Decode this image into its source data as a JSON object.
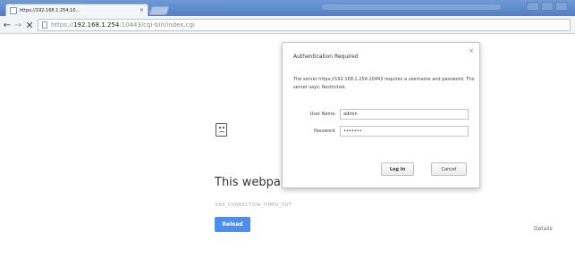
{
  "browser": {
    "tab": {
      "title": "https://192.168.1.254:10…",
      "close_glyph": "×"
    },
    "toolbar": {
      "back_glyph": "←",
      "forward_glyph": "→",
      "stop_glyph": "✕",
      "url_scheme": "https://",
      "url_host": "192.168.1.254",
      "url_rest": ":10443/cgi-bin/index.cgi"
    }
  },
  "error_page": {
    "icon": "sad-page-icon",
    "title": "This webpa",
    "code": "ERR_CONNECTION_TIMED_OUT",
    "reload_label": "Reload",
    "details_label": "Details",
    "reload_color": "#4a8ff0"
  },
  "auth_dialog": {
    "title": "Authentication Required",
    "close_glyph": "×",
    "message": "The server https://192.168.1.254:10443 requires a username and password. The server says: Restricted.",
    "username_label": "User Name:",
    "username_value": "admin",
    "password_label": "Password:",
    "password_value": "•••••••",
    "login_label": "Log In",
    "cancel_label": "Cancel"
  }
}
